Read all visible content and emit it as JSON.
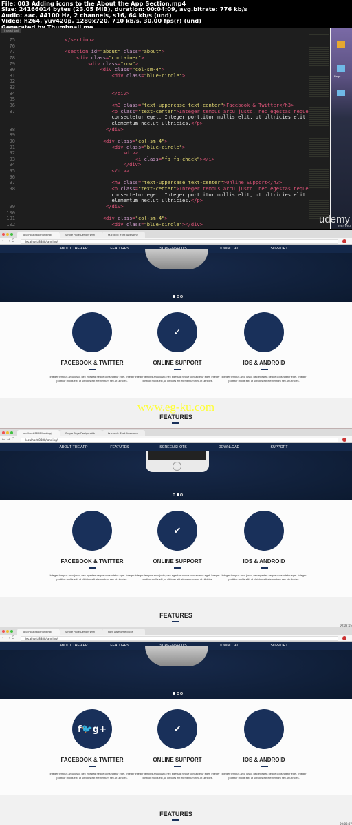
{
  "header": {
    "lines": [
      "File: 003 Adding icons to the About the App Section.mp4",
      "Size: 24166014 bytes (23.05 MiB), duration: 00:04:09, avg.bitrate: 776 kb/s",
      "Audio: aac, 44100 Hz, 2 channels, s16, 64 kb/s (und)",
      "Video: h264, yuv420p, 1280x720, 710 kb/s, 30.00 fps(r) (und)",
      "Generated by Thumbnail me"
    ]
  },
  "editor": {
    "tab": "index.html",
    "brand": "udemy",
    "timestamp": "00:01:03",
    "desktop_labels": [
      "Page"
    ],
    "lines": [
      {
        "n": "75",
        "t": "        </section>"
      },
      {
        "n": "76",
        "t": ""
      },
      {
        "n": "77",
        "t": "        <section id=\"about\" class=\"about\">"
      },
      {
        "n": "78",
        "t": "            <div class=\"container\">"
      },
      {
        "n": "79",
        "t": "                <div class=\"row\">"
      },
      {
        "n": "80",
        "t": "                    <div class=\"col-sm-4\">"
      },
      {
        "n": "81",
        "t": "                        <div class=\"blue-circle\">"
      },
      {
        "n": "82",
        "t": ""
      },
      {
        "n": "83",
        "t": ""
      },
      {
        "n": "84",
        "t": "                        </div>"
      },
      {
        "n": "85",
        "t": ""
      },
      {
        "n": "86",
        "t": "                        <h3 class=\"text-uppercase text-center\">Facebook & Twitter</h3>"
      },
      {
        "n": "87",
        "t": "                        <p class=\"text-center\">Integer tempus arcu justo, nec egestas neque"
      },
      {
        "n": "",
        "t": "                        consectetur eget. Integer porttitor mollis elit, ut ultricies elit"
      },
      {
        "n": "",
        "t": "                        elementum nec.ut ultricies.</p>"
      },
      {
        "n": "88",
        "t": "                      </div>"
      },
      {
        "n": "89",
        "t": ""
      },
      {
        "n": "90",
        "t": "                     <div class=\"col-sm-4\">"
      },
      {
        "n": "91",
        "t": "                        <div class=\"blue-circle\">"
      },
      {
        "n": "92",
        "t": "                            <div>"
      },
      {
        "n": "93",
        "t": "                                <i class=\"fa fa-check\"></i>"
      },
      {
        "n": "94",
        "t": "                            </div>"
      },
      {
        "n": "95",
        "t": "                        </div>"
      },
      {
        "n": "96",
        "t": ""
      },
      {
        "n": "97",
        "t": "                        <h3 class=\"text-uppercase text-center\">Online Support</h3>"
      },
      {
        "n": "98",
        "t": "                        <p class=\"text-center\">Integer tempus arcu justo, nec egestas neque"
      },
      {
        "n": "",
        "t": "                        consectetur eget. Integer porttitor mollis elit, ut ultricies elit"
      },
      {
        "n": "",
        "t": "                        elementum nec.ut ultricies.</p>"
      },
      {
        "n": "99",
        "t": "                      </div>"
      },
      {
        "n": "100",
        "t": ""
      },
      {
        "n": "101",
        "t": "                     <div class=\"col-sm-4\">"
      },
      {
        "n": "102",
        "t": "                        <div class=\"blue-circle\"></div>"
      }
    ]
  },
  "frames": [
    {
      "tabs": [
        "localhost:8888/landing/",
        "Single Page Design with",
        "fa-check: Font Awesome"
      ],
      "active_tab": 0,
      "url": "localhost:8888/landing/",
      "slide": 0,
      "icons": [
        "",
        "✓",
        ""
      ],
      "watermark": "www.eg-ku.com",
      "timestamp": ""
    },
    {
      "tabs": [
        "localhost:8888/landing/",
        "Single Page Design with",
        "fa-check: Font Awesome"
      ],
      "active_tab": 0,
      "url": "localhost:8888/landing/",
      "slide": 1,
      "icons": [
        "",
        "✔",
        ""
      ],
      "watermark": "",
      "timestamp": "00:02:05"
    },
    {
      "tabs": [
        "localhost:8888/landing/",
        "Single Page Design with",
        "Font Awesome Icons"
      ],
      "active_tab": 0,
      "url": "localhost:8888/landing/",
      "slide": 0,
      "icons": [
        "f🐦g+",
        "✔",
        ""
      ],
      "watermark": "",
      "timestamp": "00:03:07"
    }
  ],
  "site": {
    "nav": [
      "ABOUT THE APP",
      "FEATURES",
      "SCREENSHOTS",
      "DOWNLOAD",
      "SUPPORT"
    ],
    "cards": [
      {
        "title": "FACEBOOK & TWITTER",
        "text": "Integer tempus arcu justo, nec egestas neque consectetur eget. Integer porttitor mollis elit, ut ultricies elit elementum nec.ut ultricies."
      },
      {
        "title": "ONLINE SUPPORT",
        "text": "Integer tempus arcu justo, nec egestas neque consectetur eget. Integer porttitor mollis elit, ut ultricies elit elementum nec.ut ultricies."
      },
      {
        "title": "IOS & ANDROID",
        "text": "Integer tempus arcu justo, nec egestas neque consectetur eget. Integer porttitor mollis elit, ut ultricies elit elementum nec.ut ultricies."
      }
    ],
    "features_title": "FEATURES",
    "accent": "#19305a",
    "nav_bg": "#14284a"
  }
}
